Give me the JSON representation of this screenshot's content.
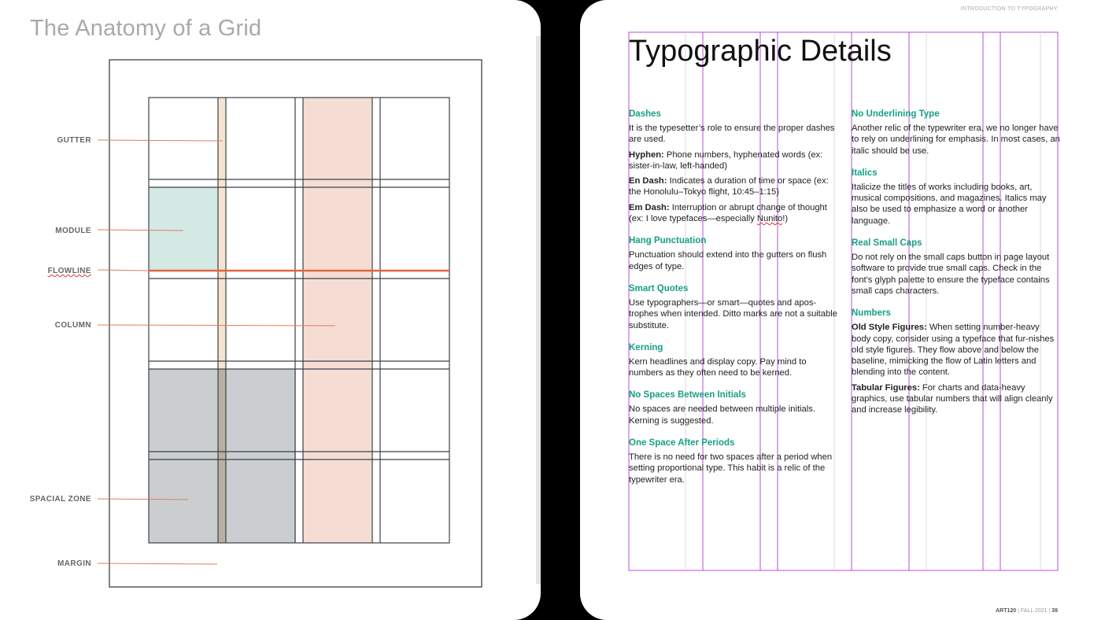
{
  "left_page": {
    "title": "The Anatomy of a Grid",
    "labels": [
      {
        "key": "gutter",
        "text": "GUTTER"
      },
      {
        "key": "module",
        "text": "MODULE"
      },
      {
        "key": "flowline",
        "text": "FLOWLINE"
      },
      {
        "key": "column",
        "text": "COLUMN"
      },
      {
        "key": "spacial",
        "text": "SPACIAL ZONE"
      },
      {
        "key": "margin",
        "text": "MARGIN"
      }
    ],
    "colors": {
      "module_fill": "#d3e9e3",
      "column_fill": "#f6ddd4",
      "gutter_fill": "#f7e3d2",
      "spacial_fill": "#caced0",
      "flowline": "#e0673f",
      "leader": "#d88060",
      "grid_line": "#3b4247"
    }
  },
  "right_page": {
    "running_head": "INTRODUCTION TO TYPOGRAPHY",
    "title": "Typographic Details",
    "accent_color": "#16a085",
    "left_column": {
      "dashes": {
        "heading": "Dashes",
        "intro": "It is the typesetter’s role to ensure the proper dashes are used.",
        "hyphen_term": "Hyphen:",
        "hyphen_text": " Phone numbers, hyphenated words (ex: sister-in-law, left-handed)",
        "endash_term": "En Dash:",
        "endash_text": " Indicates a duration of time or space (ex: the Honolulu–Tokyo flight, 10:45–1:15)",
        "emdash_term": "Em Dash:",
        "emdash_text_a": " Interruption or abrupt change of thought (ex: I love typefaces—especially ",
        "emdash_typo": "Nunito",
        "emdash_text_b": "!)"
      },
      "hang": {
        "heading": "Hang Punctuation",
        "text": "Punctuation should extend into the gutters on flush edges of type."
      },
      "quotes": {
        "heading": "Smart Quotes",
        "text": "Use typographers—or smart—quotes and apos-trophes when intended. Ditto marks are not a suitable substitute."
      },
      "kerning": {
        "heading": "Kerning",
        "text": "Kern headlines and display copy. Pay mind to numbers as they often need to be kerned."
      },
      "initials": {
        "heading": "No Spaces Between Initials",
        "text": "No spaces are needed between multiple initials. Kerning is suggested."
      },
      "one_space": {
        "heading": "One Space After Periods",
        "text": "There is no need for two spaces after a period when setting proportional type. This habit is a relic of the typewriter era."
      }
    },
    "right_column": {
      "underline": {
        "heading": "No Underlining Type",
        "text": "Another relic of the typewriter era, we no longer have to rely on underlining for emphasis. In most cases, an italic should be use."
      },
      "italics": {
        "heading": "Italics",
        "text": "Italicize the titles of works including books, art, musical compositions, and magazines. Italics may also be used to emphasize a word or another language."
      },
      "small_caps": {
        "heading": "Real Small Caps",
        "text": "Do not rely on the small caps button in page layout software to provide true small caps. Check in the font's glyph palette to ensure the typeface contains small caps characters."
      },
      "numbers": {
        "heading": "Numbers",
        "old_term": "Old Style Figures:",
        "old_text": " When setting number-heavy body copy, consider using a typeface that fur-nishes old style figures. They flow above and below the baseline, mimicking the flow of Latin letters and blending into the content.",
        "tab_term": "Tabular Figures:",
        "tab_text": " For charts and data-heavy graphics, use tabular numbers that will align cleanly and increase legibility."
      }
    },
    "folio": {
      "course": "ART120",
      "sep1": " | ",
      "term": "FALL 2021",
      "sep2": " | ",
      "page": "39"
    }
  }
}
